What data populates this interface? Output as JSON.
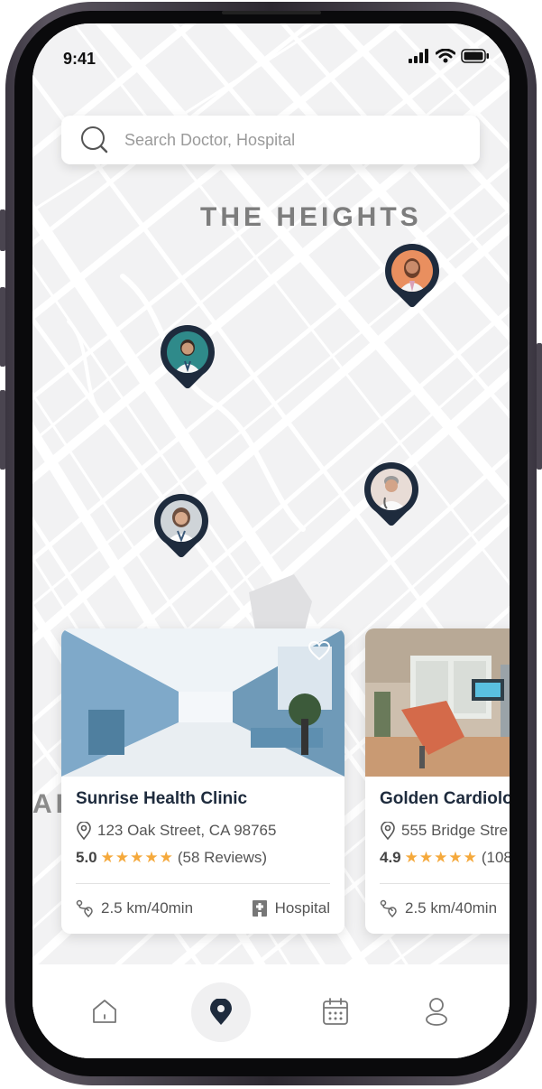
{
  "status_bar": {
    "time": "9:41"
  },
  "search": {
    "placeholder": "Search Doctor, Hospital"
  },
  "map": {
    "labels": {
      "heights": "THE HEIGHTS",
      "partial": "AL"
    }
  },
  "cards": [
    {
      "name": "Sunrise Health Clinic",
      "address": "123 Oak Street, CA 98765",
      "rating": "5.0",
      "reviews": "(58 Reviews)",
      "distance": "2.5 km/40min",
      "type": "Hospital"
    },
    {
      "name": "Golden Cardiolo",
      "address": "555 Bridge Stre",
      "rating": "4.9",
      "reviews": "(108",
      "distance": "2.5 km/40min"
    }
  ],
  "nav": {
    "items": [
      {
        "icon": "home-icon"
      },
      {
        "icon": "location-pin-icon",
        "active": true
      },
      {
        "icon": "calendar-icon"
      },
      {
        "icon": "profile-icon"
      }
    ]
  },
  "colors": {
    "pin": "#1e2b3d",
    "star": "#f5a93c",
    "map_bg": "#f2f2f3",
    "road": "#ffffff"
  }
}
